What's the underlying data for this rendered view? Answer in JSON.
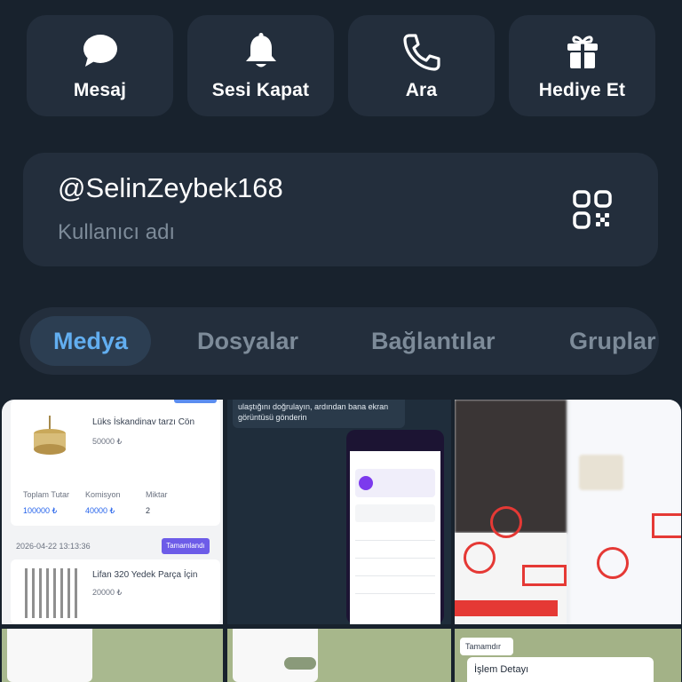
{
  "actions": [
    {
      "label": "Mesaj",
      "icon": "message-icon"
    },
    {
      "label": "Sesi Kapat",
      "icon": "bell-icon"
    },
    {
      "label": "Ara",
      "icon": "phone-icon"
    },
    {
      "label": "Hediye Et",
      "icon": "gift-icon"
    }
  ],
  "user": {
    "username": "@SelinZeybek168",
    "caption": "Kullanıcı adı",
    "qr_icon": "qr-code-icon"
  },
  "tabs": [
    {
      "label": "Medya",
      "active": true
    },
    {
      "label": "Dosyalar",
      "active": false
    },
    {
      "label": "Bağlantılar",
      "active": false
    },
    {
      "label": "Gruplar",
      "active": false
    }
  ],
  "media": {
    "tile1": {
      "item1_title": "Lüks İskandinav tarzı Cön",
      "item1_price": "50000 ₺",
      "total_label": "Toplam Tutar",
      "total_value": "100000 ₺",
      "commission_label": "Komisyon",
      "commission_value": "40000 ₺",
      "qty_label": "Miktar",
      "qty_value": "2",
      "date": "2026-04-22 13:13:36",
      "status_badge": "Tamamlandı",
      "item2_title": "Lifan 320 Yedek Parça İçin",
      "item2_price": "20000 ₺"
    },
    "tile2": {
      "chat_text": "ulaştığını doğrulayın, ardından bana ekran görüntüsü gönderin"
    },
    "tile6": {
      "badge": "Tamamdır",
      "title": "İşlem Detayı"
    }
  },
  "colors": {
    "background": "#18222d",
    "card": "#232e3c",
    "accent": "#62aef0",
    "muted": "#7d8b99"
  }
}
